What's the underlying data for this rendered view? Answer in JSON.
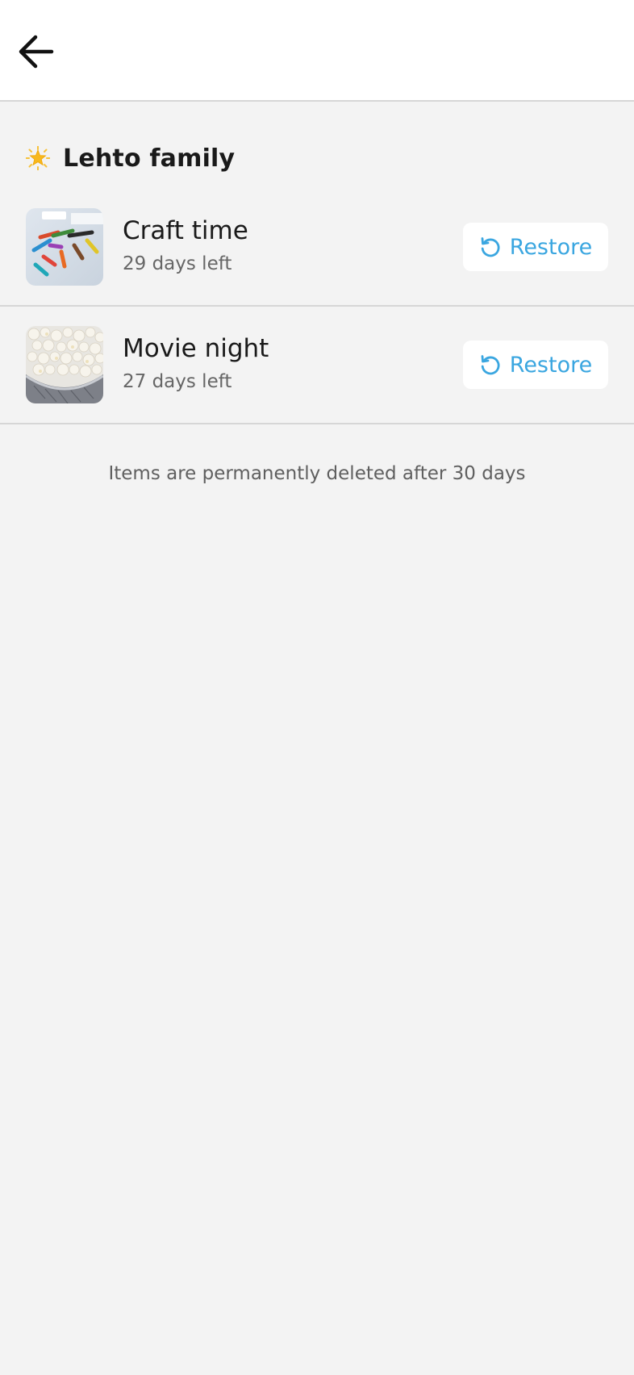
{
  "header": {
    "back_icon": "arrow-left-icon"
  },
  "group": {
    "icon": "star-icon",
    "title": "Lehto family"
  },
  "items": [
    {
      "title": "Craft time",
      "subtitle": "29 days left",
      "thumbnail": "crayons-photo",
      "restore_label": "Restore",
      "restore_icon": "restore-icon"
    },
    {
      "title": "Movie night",
      "subtitle": "27 days left",
      "thumbnail": "popcorn-photo",
      "restore_label": "Restore",
      "restore_icon": "restore-icon"
    }
  ],
  "footer": {
    "note": "Items are permanently deleted after 30 days"
  },
  "colors": {
    "accent": "#3aa6e0",
    "background": "#f3f3f3",
    "divider": "#d6d6d6"
  }
}
